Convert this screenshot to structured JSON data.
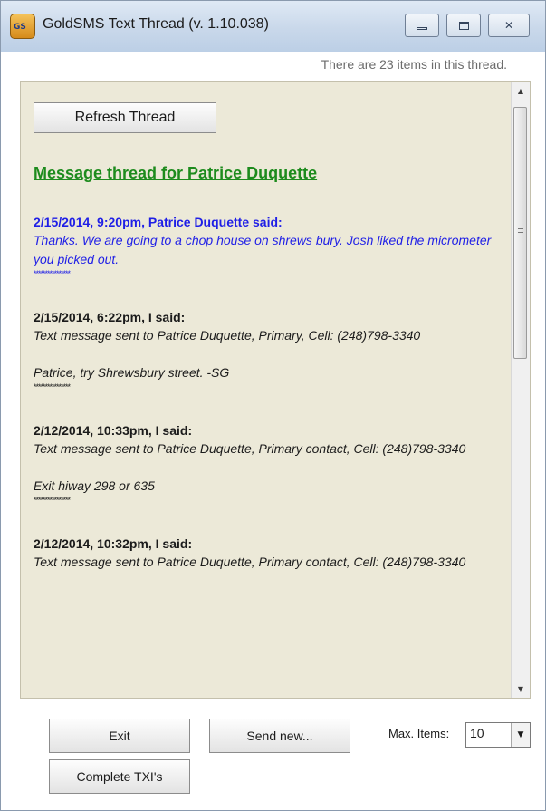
{
  "window": {
    "title": "GoldSMS Text Thread  (v. 1.10.038)",
    "icon": "goldsms-app-icon",
    "icon_text": "GS"
  },
  "item_count_text": "There are 23 items in this thread.",
  "refresh_label": "Refresh Thread",
  "thread_heading": "Message thread for Patrice Duquette",
  "messages": [
    {
      "header": "2/15/2014, 9:20pm, Patrice Duquette said:",
      "lines": [
        "Thanks. We are going to a chop house on shrews bury. Josh liked the micrometer you picked out."
      ],
      "stars": "****************",
      "incoming": true
    },
    {
      "header": "2/15/2014, 6:22pm, I said:",
      "lines": [
        "Text message sent to Patrice Duquette, Primary, Cell: (248)798-3340",
        "Patrice, try Shrewsbury street. -SG"
      ],
      "stars": "****************",
      "incoming": false
    },
    {
      "header": "2/12/2014, 10:33pm, I said:",
      "lines": [
        "Text message sent to Patrice Duquette, Primary contact, Cell: (248)798-3340",
        "Exit hiway 298 or 635"
      ],
      "stars": "****************",
      "incoming": false
    },
    {
      "header": "2/12/2014, 10:32pm, I said:",
      "lines": [
        "Text message sent to Patrice Duquette, Primary contact, Cell: (248)798-3340"
      ],
      "stars": "",
      "incoming": false
    }
  ],
  "buttons": {
    "exit": "Exit",
    "send_new": "Send new...",
    "complete_txi": "Complete TXI's"
  },
  "max_items": {
    "label": "Max. Items:",
    "value": "10"
  },
  "icons": {
    "minimize": "minimize-icon",
    "maximize": "maximize-icon",
    "close": "close-icon",
    "scroll_up": "scroll-up-arrow-icon",
    "scroll_down": "scroll-down-arrow-icon",
    "dropdown": "dropdown-arrow-icon"
  },
  "colors": {
    "heading_green": "#1d8b1d",
    "incoming_blue": "#1f1fe6",
    "panel_bg": "#ece9d8"
  }
}
